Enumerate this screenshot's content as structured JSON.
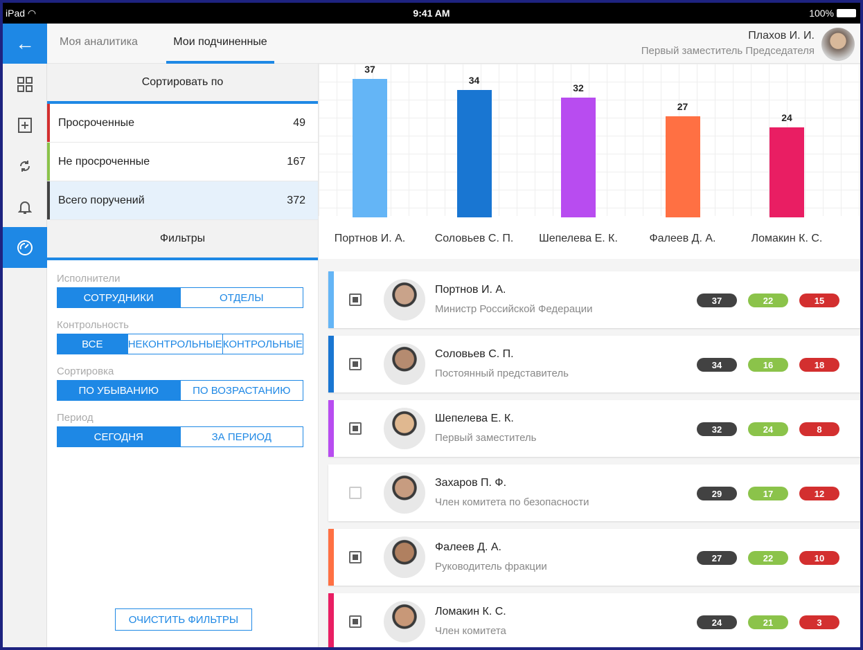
{
  "status_bar": {
    "device": "iPad",
    "time": "9:41 AM",
    "battery": "100%"
  },
  "header": {
    "tabs": [
      {
        "label": "Моя аналитика",
        "active": false
      },
      {
        "label": "Мои подчиненные",
        "active": true
      }
    ],
    "user": {
      "name": "Плахов И. И.",
      "role": "Первый заместитель Председателя"
    }
  },
  "rail_icons": [
    "back-arrow-icon",
    "grid-icon",
    "add-document-icon",
    "sync-icon",
    "bell-icon",
    "dashboard-gauge-icon"
  ],
  "sort": {
    "title": "Сортировать по",
    "items": [
      {
        "label": "Просроченные",
        "count": "49",
        "color": "#d32f2f",
        "selected": false
      },
      {
        "label": "Не просроченные",
        "count": "167",
        "color": "#8bc34a",
        "selected": false
      },
      {
        "label": "Всего поручений",
        "count": "372",
        "color": "#424242",
        "selected": true
      }
    ]
  },
  "filters": {
    "title": "Фильтры",
    "groups": [
      {
        "label": "Исполнители",
        "options": [
          "СОТРУДНИКИ",
          "ОТДЕЛЫ"
        ],
        "selected": 0
      },
      {
        "label": "Контрольность",
        "options": [
          "ВСЕ",
          "НЕКОНТРОЛЬНЫЕ",
          "КОНТРОЛЬНЫЕ"
        ],
        "selected": 0
      },
      {
        "label": "Сортировка",
        "options": [
          "ПО УБЫВАНИЮ",
          "ПО ВОЗРАСТАНИЮ"
        ],
        "selected": 0
      },
      {
        "label": "Период",
        "options": [
          "СЕГОДНЯ",
          "ЗА ПЕРИОД"
        ],
        "selected": 0
      }
    ],
    "clear_label": "ОЧИСТИТЬ ФИЛЬТРЫ"
  },
  "chart_data": {
    "type": "bar",
    "categories": [
      "Портнов И. А.",
      "Соловьев С. П.",
      "Шепелева Е. К.",
      "Фалеев Д. А.",
      "Ломакин К. С."
    ],
    "values": [
      37,
      34,
      32,
      27,
      24
    ],
    "colors": [
      "#64b5f6",
      "#1976d2",
      "#b84cf0",
      "#ff7043",
      "#e91e63"
    ],
    "ylim": [
      0,
      40
    ]
  },
  "people": [
    {
      "name": "Портнов И. А.",
      "role": "Министр Российской Федерации",
      "total": "37",
      "on_time": "22",
      "overdue": "15",
      "color": "#64b5f6",
      "checked": true
    },
    {
      "name": "Соловьев С. П.",
      "role": "Постоянный представитель",
      "total": "34",
      "on_time": "16",
      "overdue": "18",
      "color": "#1976d2",
      "checked": true
    },
    {
      "name": "Шепелева Е. К.",
      "role": "Первый заместитель",
      "total": "32",
      "on_time": "24",
      "overdue": "8",
      "color": "#b84cf0",
      "checked": true
    },
    {
      "name": "Захаров П. Ф.",
      "role": "Член комитета по безопасности",
      "total": "29",
      "on_time": "17",
      "overdue": "12",
      "color": "",
      "checked": false
    },
    {
      "name": "Фалеев Д. А.",
      "role": "Руководитель фракции",
      "total": "27",
      "on_time": "22",
      "overdue": "10",
      "color": "#ff7043",
      "checked": true
    },
    {
      "name": "Ломакин К. С.",
      "role": "Член комитета",
      "total": "24",
      "on_time": "21",
      "overdue": "3",
      "color": "#e91e63",
      "checked": true
    }
  ]
}
